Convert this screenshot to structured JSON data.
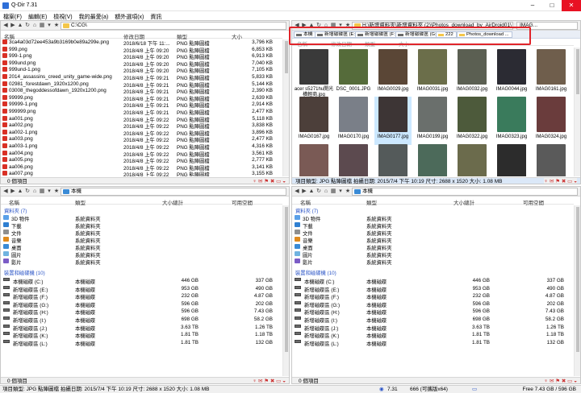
{
  "app": {
    "title": "Q-Dir 7.31"
  },
  "menu": [
    "檔案(F)",
    "編輯(E)",
    "檢視(V)",
    "我的最愛(a)",
    "額外選項(x)",
    "資訊"
  ],
  "tl": {
    "address": "C:\\CG\\",
    "columns": [
      "名稱",
      "修改日期",
      "類型",
      "大小"
    ],
    "files": [
      [
        "3ca4a03d72ee453a9b3169b0e89a299e.png",
        "2018/6/18 下午 11:...",
        "PNG 點陣圖檔",
        "3,796 KB"
      ],
      [
        "999.png",
        "2018/4/8 上午 09:20",
        "PNG 點陣圖檔",
        "6,853 KB"
      ],
      [
        "999-1.png",
        "2018/4/8 上午 09:20",
        "PNG 點陣圖檔",
        "6,913 KB"
      ],
      [
        "999und.png",
        "2018/4/8 上午 09:20",
        "PNG 點陣圖檔",
        "7,040 KB"
      ],
      [
        "999und-1.png",
        "2018/4/8 上午 09:20",
        "PNG 點陣圖檔",
        "7,105 KB"
      ],
      [
        "2014_assassins_creed_unity_game-wide.png",
        "2018/4/8 上午 09:21",
        "PNG 點陣圖檔",
        "5,833 KB"
      ],
      [
        "02981_forestdawn_1920x1200.png",
        "2018/4/8 上午 09:21",
        "PNG 點陣圖檔",
        "5,144 KB"
      ],
      [
        "03008_thegoddessofdawn_1920x1200.png",
        "2018/4/8 上午 09:21",
        "PNG 點陣圖檔",
        "2,390 KB"
      ],
      [
        "99999.png",
        "2018/4/8 上午 09:21",
        "PNG 點陣圖檔",
        "2,639 KB"
      ],
      [
        "99999-1.png",
        "2018/4/8 上午 09:21",
        "PNG 點陣圖檔",
        "2,914 KB"
      ],
      [
        "999999.png",
        "2018/4/8 上午 09:21",
        "PNG 點陣圖檔",
        "2,477 KB"
      ],
      [
        "aa001.png",
        "2018/4/8 上午 09:22",
        "PNG 點陣圖檔",
        "5,118 KB"
      ],
      [
        "aa002.png",
        "2018/4/8 上午 09:22",
        "PNG 點陣圖檔",
        "3,838 KB"
      ],
      [
        "aa002-1.png",
        "2018/4/8 上午 09:22",
        "PNG 點陣圖檔",
        "3,896 KB"
      ],
      [
        "aa003.png",
        "2018/4/8 上午 09:22",
        "PNG 點陣圖檔",
        "2,477 KB"
      ],
      [
        "aa003-1.png",
        "2018/4/8 上午 09:22",
        "PNG 點陣圖檔",
        "4,316 KB"
      ],
      [
        "aa004.png",
        "2018/4/8 上午 09:22",
        "PNG 點陣圖檔",
        "3,561 KB"
      ],
      [
        "aa005.png",
        "2018/4/8 上午 09:22",
        "PNG 點陣圖檔",
        "2,777 KB"
      ],
      [
        "aa006.png",
        "2018/4/8 上午 09:22",
        "PNG 點陣圖檔",
        "3,141 KB"
      ],
      [
        "aa007.png",
        "2018/4/8 上午 09:22",
        "PNG 點陣圖檔",
        "3,155 KB"
      ]
    ],
    "status": "0 個項目"
  },
  "tr": {
    "address": "H:\\新增資料夾\\新增資料夾 (2)\\Photos_download_by_AirDroid01\\",
    "address_right": "IMAG...",
    "tabs": [
      "本機",
      "新增磁碟區 (E:)",
      "新增磁碟區 (F:)",
      "新增磁碟區 (G:)",
      "222",
      "Photos_download ..."
    ],
    "ghost_headers": [
      "名稱",
      "修改日期",
      "類型",
      "大小"
    ],
    "thumbs": [
      [
        "acer s5271hu開光橫輕商.jpg",
        "#3a3a3a"
      ],
      [
        "DSC_0001.JPG",
        "#556b3a"
      ],
      [
        "IMAG0029.jpg",
        "#5a4636"
      ],
      [
        "IMAG0031.jpg",
        "#6b6e4a"
      ],
      [
        "IMAG0032.jpg",
        "#5b5f52"
      ],
      [
        "IMAG0044.jpg",
        "#2b2b33"
      ],
      [
        "IMAG0161.jpg",
        "#6f5e4c"
      ],
      [
        "IMAG0167.jpg",
        "#4c3f3a"
      ],
      [
        "IMAG0170.jpg",
        "#7a7f88"
      ],
      [
        "IMAG0177.jpg",
        "#3d3535"
      ],
      [
        "IMAG0199.jpg",
        "#6a6f6c"
      ],
      [
        "IMAG0322.jpg",
        "#4d5a3b"
      ],
      [
        "IMAG0323.jpg",
        "#3a7b5c"
      ],
      [
        "IMAG0324.jpg",
        "#6a3c3c"
      ],
      [
        "IMAG0325.jpg",
        "#7a5a55"
      ],
      [
        "IMAG0326.jpg",
        "#5c4a4f"
      ],
      [
        "IMAG0570.jpg",
        "#545a5a"
      ],
      [
        "IMAG0571.jpg",
        "#4c6a5a"
      ],
      [
        "IMAG0707.jpg",
        "#6b6b4c"
      ],
      [
        "IMAG0708.jpg",
        "#2c2c2c"
      ],
      [
        "IMAG0709.jpg",
        "#5a5a5a"
      ]
    ],
    "selected": "IMAG0177.jpg",
    "status": "項目類型: JPG 點陣圖檔 拍攝日期: 2015/7/4 下午 10:19 尺寸: 2688 x 1520 大小: 1.08 MB"
  },
  "bl": {
    "address": "本機",
    "columns": [
      "名稱",
      "類型",
      "大小總計",
      "可用空間"
    ],
    "group_folders": "資料夾 (7)",
    "folders": [
      [
        "3D 物件",
        "系統資料夾",
        "#5aa0e8"
      ],
      [
        "下載",
        "系統資料夾",
        "#2f7fd1"
      ],
      [
        "文件",
        "系統資料夾",
        "#8f8f8f"
      ],
      [
        "音樂",
        "系統資料夾",
        "#e08a1c"
      ],
      [
        "桌面",
        "系統資料夾",
        "#3a8bd6"
      ],
      [
        "圖片",
        "系統資料夾",
        "#6fb3e0"
      ],
      [
        "影片",
        "系統資料夾",
        "#7b5cc6"
      ]
    ],
    "group_drives": "裝置和磁碟機 (10)",
    "drives": [
      [
        "本機磁碟 (C:)",
        "本機磁碟",
        "446 GB",
        "337 GB"
      ],
      [
        "新增磁碟區 (E:)",
        "本機磁碟",
        "953 GB",
        "490 GB"
      ],
      [
        "新增磁碟區 (F:)",
        "本機磁碟",
        "232 GB",
        "4.87 GB"
      ],
      [
        "新增磁碟區 (G:)",
        "本機磁碟",
        "596 GB",
        "202 GB"
      ],
      [
        "新增磁碟區 (H:)",
        "本機磁碟",
        "596 GB",
        "7.43 GB"
      ],
      [
        "新增磁碟區 (I:)",
        "本機磁碟",
        "698 GB",
        "58.2 GB"
      ],
      [
        "新增磁碟區 (J:)",
        "本機磁碟",
        "3.63 TB",
        "1.26 TB"
      ],
      [
        "新增磁碟區 (K:)",
        "本機磁碟",
        "1.81 TB",
        "1.18 TB"
      ],
      [
        "新增磁碟區 (L:)",
        "本機磁碟",
        "1.81 TB",
        "132 GB"
      ]
    ],
    "status": "0 個項目"
  },
  "br": {
    "address": "本機",
    "status": "0 個項目"
  },
  "bottom": {
    "left": "項目類型: JPG 點陣圖檔 拍攝日期: 2015/7/4 下午 10:19 尺寸: 2688 x 1520 大小: 1.08 MB",
    "version": "7.31",
    "free": "666 (可攜版x64)",
    "disk": "Free 7.43 GB / 596 GB"
  },
  "colors": {
    "highlight": "#e0242a",
    "selection": "#cce8ff",
    "group": "#2b55c7"
  }
}
